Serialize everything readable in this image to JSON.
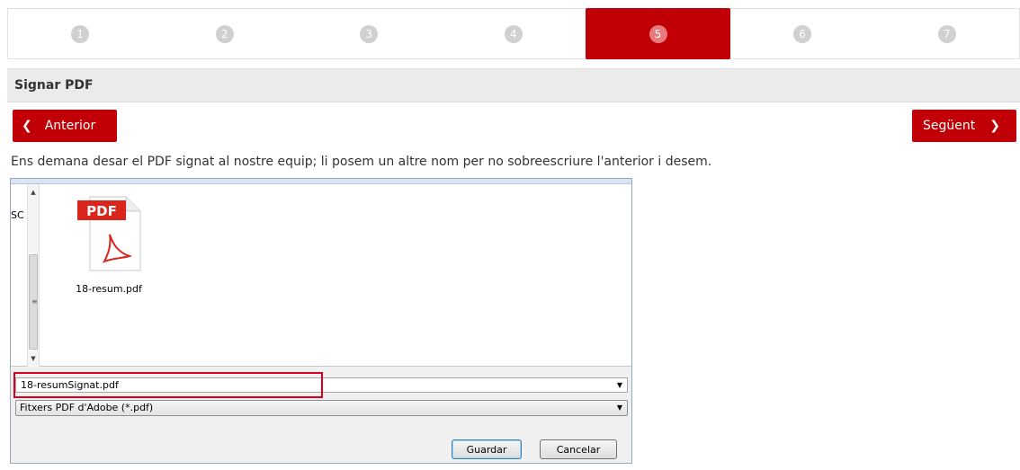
{
  "steps": [
    "1",
    "2",
    "3",
    "4",
    "5",
    "6",
    "7"
  ],
  "active_step": "5",
  "section_title": "Signar PDF",
  "nav": {
    "prev_label": "Anterior",
    "next_label": "Següent"
  },
  "instruction": "Ens demana desar el PDF signat al nostre equip; li posem un altre nom per no sobreescriure l'anterior i desem.",
  "dialog": {
    "left_label": "SC",
    "file": {
      "icon_label": "PDF",
      "name": "18-resum.pdf"
    },
    "filename_value": "18-resumSignat.pdf",
    "filetype": "Fitxers PDF d'Adobe (*.pdf)",
    "save_label": "Guardar",
    "cancel_label": "Cancelar"
  },
  "colors": {
    "accent": "#c00006",
    "highlight": "#d6001c"
  }
}
